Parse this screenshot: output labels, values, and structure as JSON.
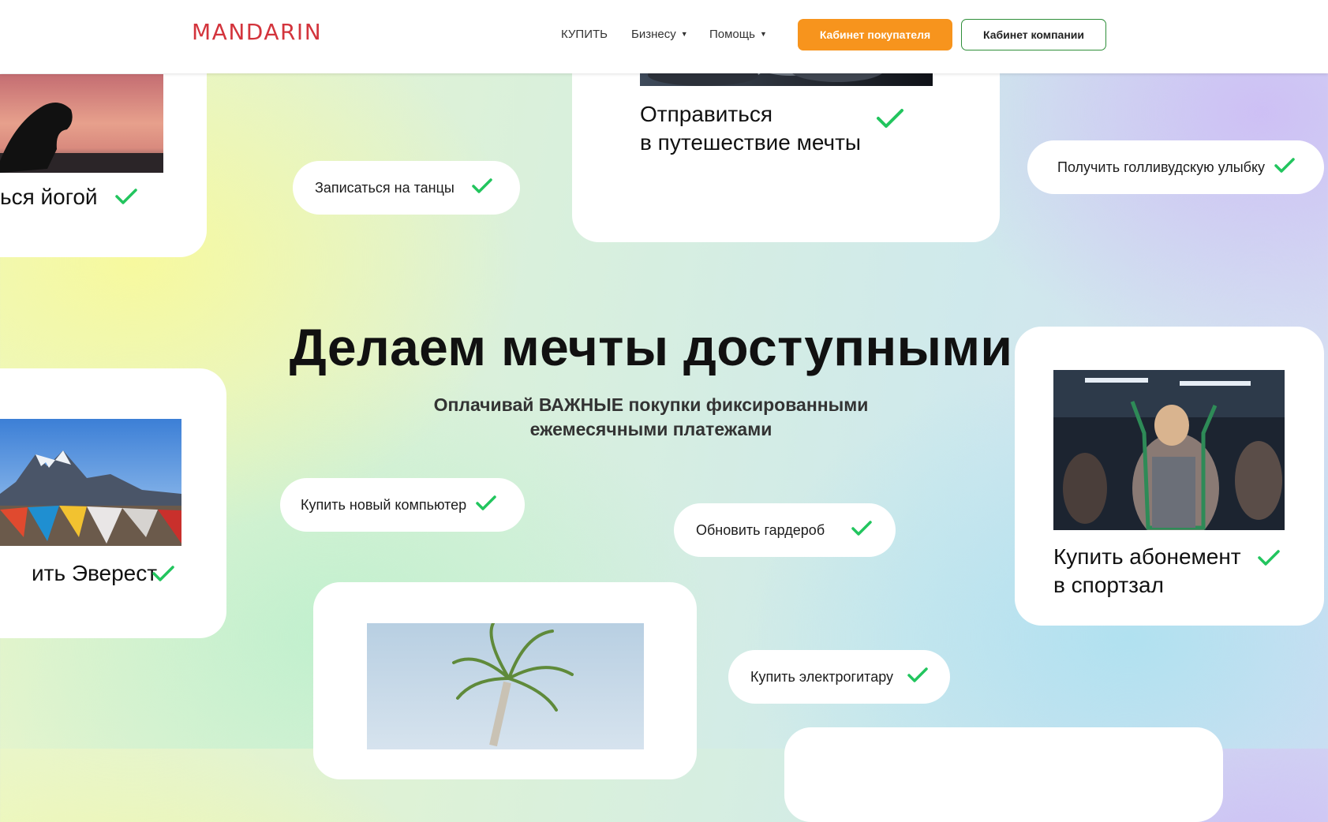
{
  "header": {
    "logo": "MANDARIN",
    "nav": [
      {
        "label": "КУПИТЬ"
      },
      {
        "label": "Бизнесу",
        "dropdown": true
      },
      {
        "label": "Помощь",
        "dropdown": true
      }
    ],
    "buyer_cabinet": "Кабинет покупателя",
    "company_cabinet": "Кабинет компании"
  },
  "hero": {
    "title": "Делаем мечты доступными",
    "subtitle_line1": "Оплачивай ВАЖНЫЕ покупки фиксированными",
    "subtitle_line2": "ежемесячными платежами"
  },
  "cards": {
    "yoga": "ься йогой",
    "travel_line1": "Отправиться",
    "travel_line2": "в путешествие мечты",
    "everest": "ить Эверест",
    "gym_line1": "Купить абонемент",
    "gym_line2": "в спортзал"
  },
  "pills": {
    "dance": "Записаться на танцы",
    "smile": "Получить голливудскую улыбку",
    "computer": "Купить новый компьютер",
    "wardrobe": "Обновить гардероб",
    "guitar": "Купить электрогитару"
  },
  "colors": {
    "brand": "#d3343c",
    "accent_orange": "#f7941d",
    "accent_green": "#2f8f3a",
    "check_green": "#22c55e"
  }
}
